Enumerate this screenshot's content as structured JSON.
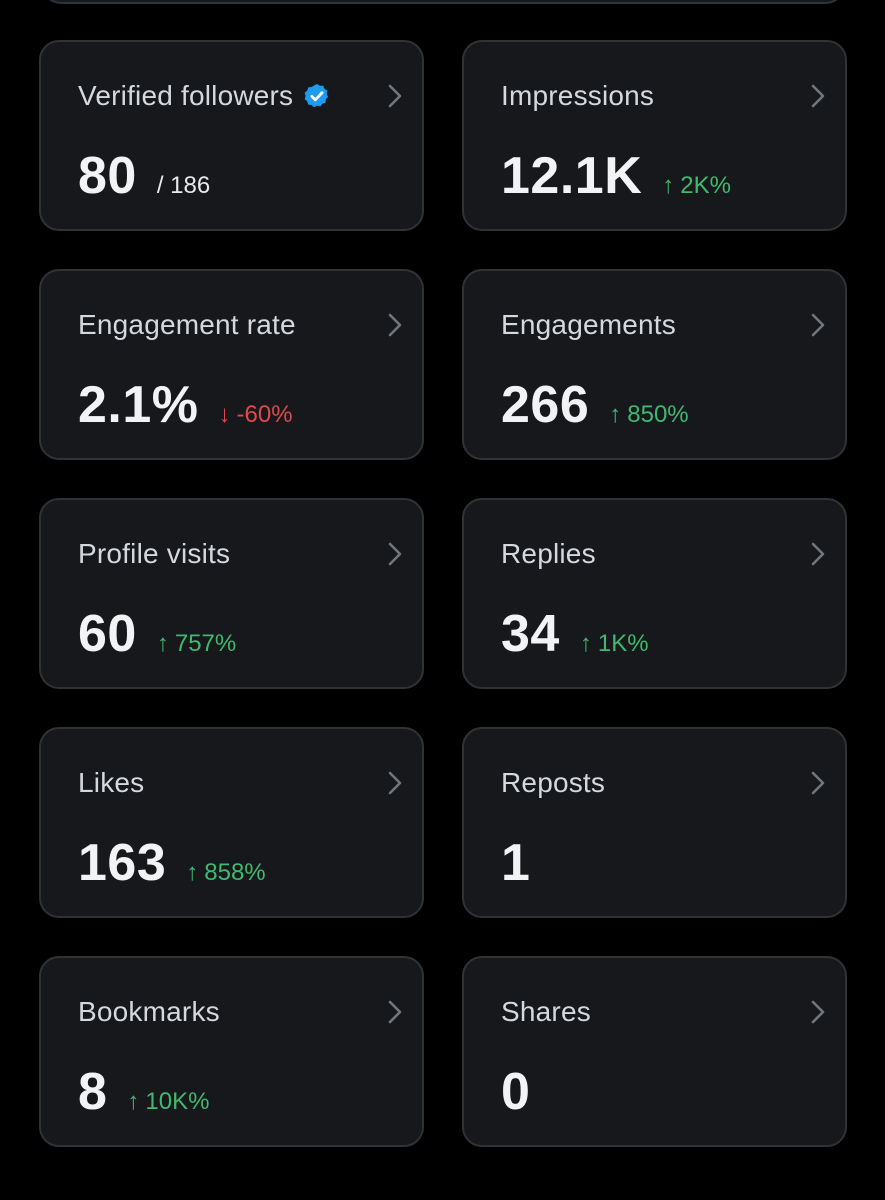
{
  "colors": {
    "background": "#000000",
    "card_background": "#16181c",
    "card_border": "#2f3336",
    "positive": "#3fb96f",
    "negative": "#e0474e",
    "verified": "#1d9bf0"
  },
  "metrics": [
    {
      "label": "Verified followers",
      "value": "80",
      "sub_total": "/ 186",
      "delta": "",
      "delta_arrow": "",
      "verified_badge": true
    },
    {
      "label": "Impressions",
      "value": "12.1K",
      "delta": "2K%",
      "delta_arrow": "↑",
      "direction": "up"
    },
    {
      "label": "Engagement rate",
      "value": "2.1%",
      "delta": "-60%",
      "delta_arrow": "↓",
      "direction": "down"
    },
    {
      "label": "Engagements",
      "value": "266",
      "delta": "850%",
      "delta_arrow": "↑",
      "direction": "up"
    },
    {
      "label": "Profile visits",
      "value": "60",
      "delta": "757%",
      "delta_arrow": "↑",
      "direction": "up"
    },
    {
      "label": "Replies",
      "value": "34",
      "delta": "1K%",
      "delta_arrow": "↑",
      "direction": "up"
    },
    {
      "label": "Likes",
      "value": "163",
      "delta": "858%",
      "delta_arrow": "↑",
      "direction": "up"
    },
    {
      "label": "Reposts",
      "value": "1",
      "delta": "",
      "delta_arrow": ""
    },
    {
      "label": "Bookmarks",
      "value": "8",
      "delta": "10K%",
      "delta_arrow": "↑",
      "direction": "up"
    },
    {
      "label": "Shares",
      "value": "0",
      "delta": "",
      "delta_arrow": ""
    }
  ]
}
